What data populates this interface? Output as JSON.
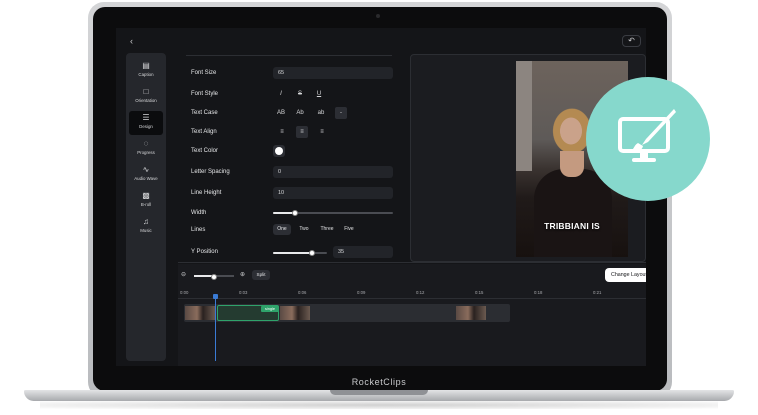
{
  "app": {
    "brand_label": "RocketClips"
  },
  "topbar": {
    "back_icon": "back-arrow-icon",
    "undo_icon": "undo-icon"
  },
  "sidebar": {
    "items": [
      {
        "label": "Caption",
        "icon": "caption-icon",
        "active": false
      },
      {
        "label": "Orientation",
        "icon": "orientation-icon",
        "active": false
      },
      {
        "label": "Design",
        "icon": "sliders-icon",
        "active": true
      },
      {
        "label": "Progress",
        "icon": "progress-icon",
        "active": false
      },
      {
        "label": "Audio Wave",
        "icon": "audio-wave-icon",
        "active": false
      },
      {
        "label": "B-roll",
        "icon": "broll-icon",
        "active": false
      },
      {
        "label": "Music",
        "icon": "music-icon",
        "active": false
      }
    ]
  },
  "design": {
    "font_size": {
      "label": "Font Size",
      "value": "65"
    },
    "font_style": {
      "label": "Font Style",
      "options": [
        "I",
        "S",
        "U"
      ]
    },
    "text_case": {
      "label": "Text Case",
      "options": [
        "AB",
        "Ab",
        "ab",
        "-"
      ]
    },
    "text_align": {
      "label": "Text Align",
      "options": [
        "align-left",
        "align-center",
        "align-right"
      ],
      "selected": "align-center"
    },
    "text_color": {
      "label": "Text Color",
      "value": "#ffffff"
    },
    "letter_spacing": {
      "label": "Letter Spacing",
      "value": "0"
    },
    "line_height": {
      "label": "Line Height",
      "value": "10"
    },
    "width": {
      "label": "Width",
      "fraction": 0.18
    },
    "lines": {
      "label": "Lines",
      "options": [
        "One",
        "Two",
        "Three",
        "Five"
      ],
      "selected": "One"
    },
    "y_position": {
      "label": "Y Position",
      "value": "35",
      "fraction": 0.72
    }
  },
  "preview": {
    "caption_text": "TRIBBIANI IS"
  },
  "timeline": {
    "zoom_fraction": 0.5,
    "split_label": "Split",
    "change_layout_label": "Change Layout",
    "ticks": [
      "0:00",
      "0:03",
      "0:06",
      "0:09",
      "0:12",
      "0:15",
      "0:18",
      "0:21"
    ],
    "clip_tag": "single"
  },
  "badge": {
    "icon": "design-monitor-brush-icon",
    "color": "#86d8cc"
  }
}
